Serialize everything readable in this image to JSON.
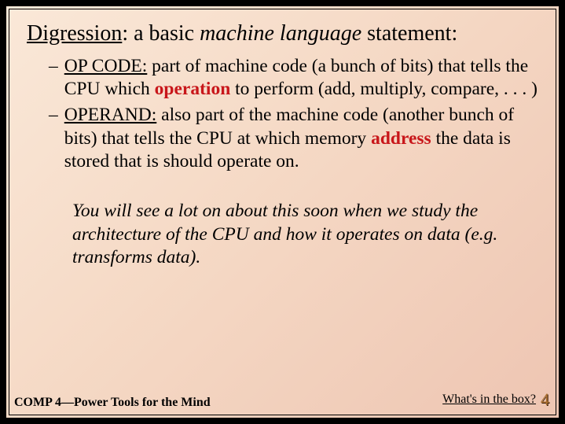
{
  "title": {
    "part1": "Digression",
    "sep1": ":  a basic ",
    "italic": "machine language",
    "sep2": " statement:"
  },
  "bullets": [
    {
      "dash": "–",
      "term": "OP CODE:",
      "pre": "  part of machine code (a bunch of bits) that tells the CPU which ",
      "red": "operation",
      "post": " to perform (add, multiply, compare, . . . )"
    },
    {
      "dash": "–",
      "term": "OPERAND:",
      "pre": "  also part of the machine code (another bunch of bits) that tells the CPU at which memory ",
      "red": "address",
      "post": " the data is stored that is should operate on."
    }
  ],
  "note": "You will see a lot on about this soon when we study the architecture of the CPU and how it operates on data (e.g. transforms data).",
  "footer": {
    "left": "COMP 4—Power Tools for the Mind",
    "right": "What's in the box?",
    "page": "4"
  }
}
